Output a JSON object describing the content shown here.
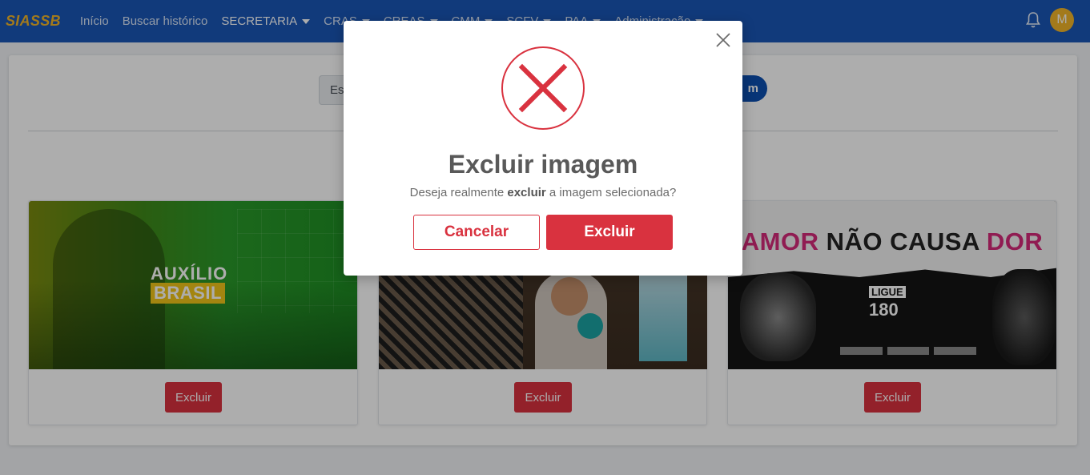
{
  "navbar": {
    "brand": "SIASSB",
    "items": [
      {
        "label": "Início",
        "dropdown": false
      },
      {
        "label": "Buscar histórico",
        "dropdown": false
      },
      {
        "label": "SECRETARIA",
        "dropdown": true
      },
      {
        "label": "CRAS",
        "dropdown": true
      },
      {
        "label": "CREAS",
        "dropdown": true
      },
      {
        "label": "CMM",
        "dropdown": true
      },
      {
        "label": "SCFV",
        "dropdown": true
      },
      {
        "label": "PAA",
        "dropdown": true
      },
      {
        "label": "Administração",
        "dropdown": true
      }
    ],
    "avatar_initial": "M",
    "brand_color": "#f0b429",
    "bg_color": "#1a56b5"
  },
  "upload": {
    "file_input_text": "Esc",
    "button_label": "m"
  },
  "gallery": [
    {
      "image_alt": "Auxílio Brasil",
      "image_text_line1": "AUXÍLIO",
      "image_text_line2": "BRASIL",
      "delete_label": "Excluir"
    },
    {
      "image_alt": "Mother and baby with ball",
      "delete_label": "Excluir"
    },
    {
      "image_alt": "Amor não causa dor",
      "headline_part1": "AMOR",
      "headline_part2": "NÃO CAUSA",
      "headline_part3": "DOR",
      "ligue_label": "LIGUE",
      "ligue_number": "180",
      "delete_label": "Excluir"
    }
  ],
  "modal": {
    "title": "Excluir imagem",
    "text_before": "Deseja realmente",
    "text_bold": "excluir",
    "text_after": "a imagem selecionada?",
    "cancel_label": "Cancelar",
    "confirm_label": "Excluir",
    "danger_color": "#d9323f"
  }
}
